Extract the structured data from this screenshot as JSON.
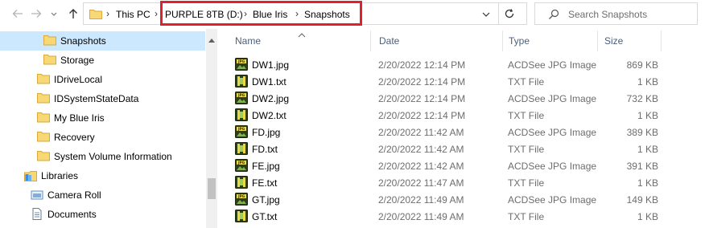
{
  "address_bar": {
    "breadcrumbs": [
      "This PC",
      "PURPLE 8TB (D:)",
      "Blue Iris",
      "Snapshots"
    ]
  },
  "search": {
    "placeholder": "Search Snapshots"
  },
  "nav": {
    "items": [
      {
        "label": "Snapshots",
        "icon": "folder-icon",
        "selected": true
      },
      {
        "label": "Storage",
        "icon": "folder-icon"
      },
      {
        "label": "IDriveLocal",
        "icon": "folder-icon"
      },
      {
        "label": "IDSystemStateData",
        "icon": "folder-icon"
      },
      {
        "label": "My Blue Iris",
        "icon": "folder-icon"
      },
      {
        "label": "Recovery",
        "icon": "folder-icon"
      },
      {
        "label": "System Volume Information",
        "icon": "folder-icon"
      },
      {
        "label": "Libraries",
        "icon": "libraries-icon"
      },
      {
        "label": "Camera Roll",
        "icon": "camera-roll-icon"
      },
      {
        "label": "Documents",
        "icon": "documents-icon"
      }
    ]
  },
  "list": {
    "columns": {
      "name": "Name",
      "date": "Date",
      "type": "Type",
      "size": "Size"
    },
    "files": [
      {
        "name": "DW1.jpg",
        "date": "2/20/2022 12:14 PM",
        "type": "ACDSee JPG Image",
        "size": "869 KB",
        "kind": "jpg"
      },
      {
        "name": "DW1.txt",
        "date": "2/20/2022 12:14 PM",
        "type": "TXT File",
        "size": "1 KB",
        "kind": "txt"
      },
      {
        "name": "DW2.jpg",
        "date": "2/20/2022 12:14 PM",
        "type": "ACDSee JPG Image",
        "size": "732 KB",
        "kind": "jpg"
      },
      {
        "name": "DW2.txt",
        "date": "2/20/2022 12:14 PM",
        "type": "TXT File",
        "size": "1 KB",
        "kind": "txt"
      },
      {
        "name": "FD.jpg",
        "date": "2/20/2022 11:42 AM",
        "type": "ACDSee JPG Image",
        "size": "389 KB",
        "kind": "jpg"
      },
      {
        "name": "FD.txt",
        "date": "2/20/2022 11:42 AM",
        "type": "TXT File",
        "size": "1 KB",
        "kind": "txt"
      },
      {
        "name": "FE.jpg",
        "date": "2/20/2022 11:42 AM",
        "type": "ACDSee JPG Image",
        "size": "391 KB",
        "kind": "jpg"
      },
      {
        "name": "FE.txt",
        "date": "2/20/2022 11:47 AM",
        "type": "TXT File",
        "size": "1 KB",
        "kind": "txt"
      },
      {
        "name": "GT.jpg",
        "date": "2/20/2022 11:49 AM",
        "type": "ACDSee JPG Image",
        "size": "149 KB",
        "kind": "jpg"
      },
      {
        "name": "GT.txt",
        "date": "2/20/2022 11:49 AM",
        "type": "TXT File",
        "size": "1 KB",
        "kind": "txt"
      }
    ]
  },
  "colors": {
    "highlight": "#e0202e",
    "selection": "#cce8ff",
    "header_text": "#4c607a"
  }
}
